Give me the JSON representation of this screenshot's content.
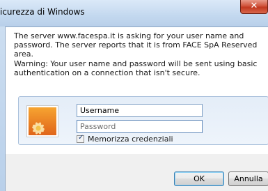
{
  "window": {
    "title": "icurezza di Windows",
    "close_glyph": "✕"
  },
  "message": {
    "line1": "The server www.facespa.it is asking for your user name and password. The server reports that it is from FACE SpA Reserved area.",
    "warning": "Warning: Your user name and password will be sent using basic authentication on a connection that isn't secure."
  },
  "credentials": {
    "avatar_icon": "user-flower-icon",
    "username_value": "Username",
    "password_placeholder": "Password",
    "remember_label": "Memorizza credenziali",
    "remember_checked": true,
    "check_glyph": "✓"
  },
  "buttons": {
    "ok_label": "OK",
    "cancel_label": "Annulla"
  },
  "colors": {
    "accent": "#3c7fb1",
    "close_red": "#c2381f"
  }
}
